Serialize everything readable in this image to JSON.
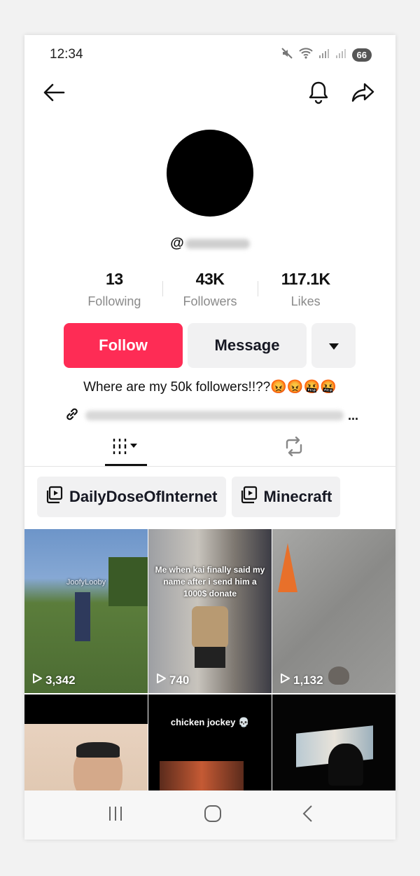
{
  "status_bar": {
    "time": "12:34",
    "battery": "66",
    "icons": [
      "mute-icon",
      "wifi-icon",
      "signal-icon",
      "signal-icon"
    ]
  },
  "header": {
    "back_icon": "arrow-left-icon",
    "bell_icon": "bell-icon",
    "share_icon": "share-icon"
  },
  "profile": {
    "username_prefix": "@",
    "stats": [
      {
        "value": "13",
        "label": "Following"
      },
      {
        "value": "43K",
        "label": "Followers"
      },
      {
        "value": "117.1K",
        "label": "Likes"
      }
    ],
    "follow_label": "Follow",
    "message_label": "Message",
    "bio": "Where are my 50k followers!!??😡😡🤬🤬",
    "link_ellipsis": "..."
  },
  "colors": {
    "follow_bg": "#fe2c55",
    "button_bg": "#f1f1f2"
  },
  "playlists": [
    {
      "label": "DailyDoseOfInternet"
    },
    {
      "label": "Minecraft"
    }
  ],
  "videos": [
    {
      "views": "3,342",
      "overlay": "JoofyLooby"
    },
    {
      "views": "740",
      "overlay": "Me when kai finally said my name after i send him a 1000$ donate"
    },
    {
      "views": "1,132",
      "overlay": ""
    },
    {
      "views": "",
      "overlay": ""
    },
    {
      "views": "",
      "overlay": "chicken jockey 💀"
    },
    {
      "views": "",
      "overlay": ""
    }
  ]
}
